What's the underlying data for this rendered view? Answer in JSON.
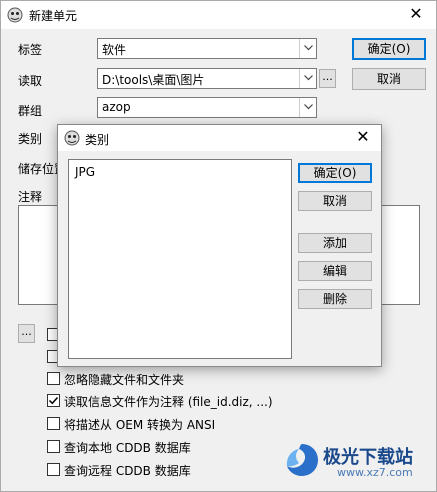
{
  "window": {
    "title": "新建单元"
  },
  "form": {
    "label_tag": "标签",
    "tag_value": "软件",
    "label_read": "读取",
    "read_value": "D:\\tools\\桌面\\图片",
    "browse_label": "...",
    "label_group": "群组",
    "group_value": "azop",
    "label_category": "类别",
    "label_storage": "储存位置",
    "label_note": "注释"
  },
  "buttons": {
    "ok": "确定(O)",
    "cancel": "取消"
  },
  "options": {
    "more_label": "...",
    "items": [
      {
        "label": "",
        "checked": false
      },
      {
        "label": "",
        "checked": false
      },
      {
        "label": "忽略隐藏文件和文件夹",
        "checked": false
      },
      {
        "label": "读取信息文件作为注释 (file_id.diz, ...)",
        "checked": true
      },
      {
        "label": "将描述从 OEM 转换为 ANSI",
        "checked": false
      },
      {
        "label": "查询本地 CDDB 数据库",
        "checked": false
      },
      {
        "label": "查询远程 CDDB 数据库",
        "checked": false
      }
    ]
  },
  "dialog": {
    "title": "类别",
    "list_items": [
      "JPG"
    ],
    "ok": "确定(O)",
    "cancel": "取消",
    "add": "添加",
    "edit": "编辑",
    "delete": "删除"
  },
  "watermark": {
    "brand": "极光下载站",
    "url": "www.xz7.com"
  },
  "colors": {
    "accent": "#0078d7",
    "watermark": "#1b4a8c"
  }
}
